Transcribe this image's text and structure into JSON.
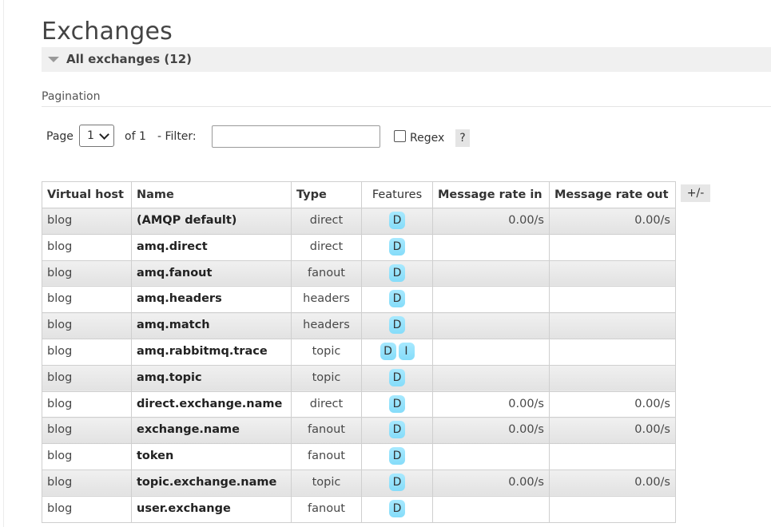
{
  "page": {
    "title": "Exchanges"
  },
  "section": {
    "title": "All exchanges (12)"
  },
  "pagination": {
    "label": "Pagination",
    "page_label": "Page",
    "page_value": "1",
    "of_label": "of 1",
    "filter_label": "- Filter:",
    "filter_value": "",
    "regex_label": "Regex",
    "regex_checked": false,
    "help_label": "?"
  },
  "table": {
    "columns": [
      "Virtual host",
      "Name",
      "Type",
      "Features",
      "Message rate in",
      "Message rate out"
    ],
    "toggle_label": "+/-",
    "rows": [
      {
        "vhost": "blog",
        "name": "(AMQP default)",
        "type": "direct",
        "features": [
          "D"
        ],
        "rate_in": "0.00/s",
        "rate_out": "0.00/s"
      },
      {
        "vhost": "blog",
        "name": "amq.direct",
        "type": "direct",
        "features": [
          "D"
        ],
        "rate_in": "",
        "rate_out": ""
      },
      {
        "vhost": "blog",
        "name": "amq.fanout",
        "type": "fanout",
        "features": [
          "D"
        ],
        "rate_in": "",
        "rate_out": ""
      },
      {
        "vhost": "blog",
        "name": "amq.headers",
        "type": "headers",
        "features": [
          "D"
        ],
        "rate_in": "",
        "rate_out": ""
      },
      {
        "vhost": "blog",
        "name": "amq.match",
        "type": "headers",
        "features": [
          "D"
        ],
        "rate_in": "",
        "rate_out": ""
      },
      {
        "vhost": "blog",
        "name": "amq.rabbitmq.trace",
        "type": "topic",
        "features": [
          "D",
          "I"
        ],
        "rate_in": "",
        "rate_out": ""
      },
      {
        "vhost": "blog",
        "name": "amq.topic",
        "type": "topic",
        "features": [
          "D"
        ],
        "rate_in": "",
        "rate_out": ""
      },
      {
        "vhost": "blog",
        "name": "direct.exchange.name",
        "type": "direct",
        "features": [
          "D"
        ],
        "rate_in": "0.00/s",
        "rate_out": "0.00/s"
      },
      {
        "vhost": "blog",
        "name": "exchange.name",
        "type": "fanout",
        "features": [
          "D"
        ],
        "rate_in": "0.00/s",
        "rate_out": "0.00/s"
      },
      {
        "vhost": "blog",
        "name": "token",
        "type": "fanout",
        "features": [
          "D"
        ],
        "rate_in": "",
        "rate_out": ""
      },
      {
        "vhost": "blog",
        "name": "topic.exchange.name",
        "type": "topic",
        "features": [
          "D"
        ],
        "rate_in": "0.00/s",
        "rate_out": "0.00/s"
      },
      {
        "vhost": "blog",
        "name": "user.exchange",
        "type": "fanout",
        "features": [
          "D"
        ],
        "rate_in": "",
        "rate_out": ""
      }
    ]
  },
  "colors": {
    "feature_badge": "#99e4ff",
    "section_bar": "#f0f0f0",
    "row_odd": "#e9e9e9"
  }
}
